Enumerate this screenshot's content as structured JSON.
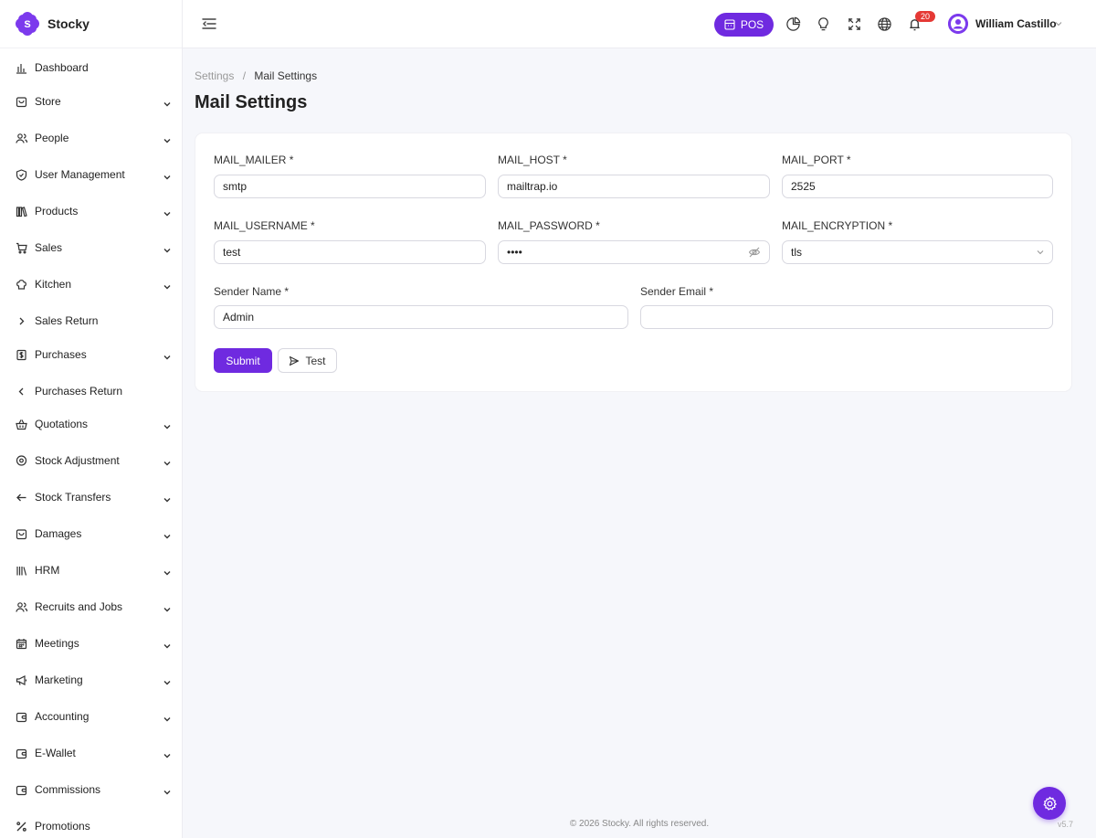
{
  "app": {
    "brand_name": "Stocky",
    "accent_color": "#6f2ae0"
  },
  "sidebar": {
    "items": [
      {
        "label": "Dashboard",
        "icon": "bar-chart-icon",
        "has_chevron": false
      },
      {
        "label": "Store",
        "icon": "store-bag-icon",
        "has_chevron": true
      },
      {
        "label": "People",
        "icon": "people-icon",
        "has_chevron": true
      },
      {
        "label": "User Management",
        "icon": "shield-check-icon",
        "has_chevron": true
      },
      {
        "label": "Products",
        "icon": "books-icon",
        "has_chevron": true
      },
      {
        "label": "Sales",
        "icon": "cart-icon",
        "has_chevron": true
      },
      {
        "label": "Kitchen",
        "icon": "chef-hat-icon",
        "has_chevron": true
      },
      {
        "label": "Sales Return",
        "icon": "chevron-right-icon",
        "has_chevron": false
      },
      {
        "label": "Purchases",
        "icon": "dollar-receipt-icon",
        "has_chevron": true
      },
      {
        "label": "Purchases Return",
        "icon": "chevron-left-icon",
        "has_chevron": false
      },
      {
        "label": "Quotations",
        "icon": "basket-icon",
        "has_chevron": true
      },
      {
        "label": "Stock Adjustment",
        "icon": "location-pin-icon",
        "has_chevron": true
      },
      {
        "label": "Stock Transfers",
        "icon": "arrow-left-icon",
        "has_chevron": true
      },
      {
        "label": "Damages",
        "icon": "damaged-box-icon",
        "has_chevron": true
      },
      {
        "label": "HRM",
        "icon": "library-icon",
        "has_chevron": true
      },
      {
        "label": "Recruits and Jobs",
        "icon": "people-icon",
        "has_chevron": true
      },
      {
        "label": "Meetings",
        "icon": "calendar-icon",
        "has_chevron": true
      },
      {
        "label": "Marketing",
        "icon": "megaphone-icon",
        "has_chevron": true
      },
      {
        "label": "Accounting",
        "icon": "wallet-icon",
        "has_chevron": true
      },
      {
        "label": "E-Wallet",
        "icon": "wallet-icon",
        "has_chevron": true
      },
      {
        "label": "Commissions",
        "icon": "wallet-icon",
        "has_chevron": true
      },
      {
        "label": "Promotions",
        "icon": "percent-icon",
        "has_chevron": false
      }
    ]
  },
  "topbar": {
    "pos_label": "POS",
    "notification_count": "20",
    "user_name": "William Castillo"
  },
  "breadcrumb": {
    "parent": "Settings",
    "separator": "/",
    "current": "Mail Settings"
  },
  "page": {
    "title": "Mail Settings"
  },
  "form": {
    "mail_mailer": {
      "label": "MAIL_MAILER *",
      "value": "smtp"
    },
    "mail_host": {
      "label": "MAIL_HOST *",
      "value": "mailtrap.io"
    },
    "mail_port": {
      "label": "MAIL_PORT *",
      "value": "2525"
    },
    "mail_username": {
      "label": "MAIL_USERNAME *",
      "value": "test"
    },
    "mail_password": {
      "label": "MAIL_PASSWORD *",
      "value": "test"
    },
    "mail_encryption": {
      "label": "MAIL_ENCRYPTION *",
      "value": "tls"
    },
    "sender_name": {
      "label": "Sender Name *",
      "value": "Admin"
    },
    "sender_email": {
      "label": "Sender Email *",
      "value": ""
    },
    "submit_label": "Submit",
    "test_label": "Test"
  },
  "footer": {
    "copyright": "© 2026 Stocky. All rights reserved.",
    "version": "v5.7"
  }
}
